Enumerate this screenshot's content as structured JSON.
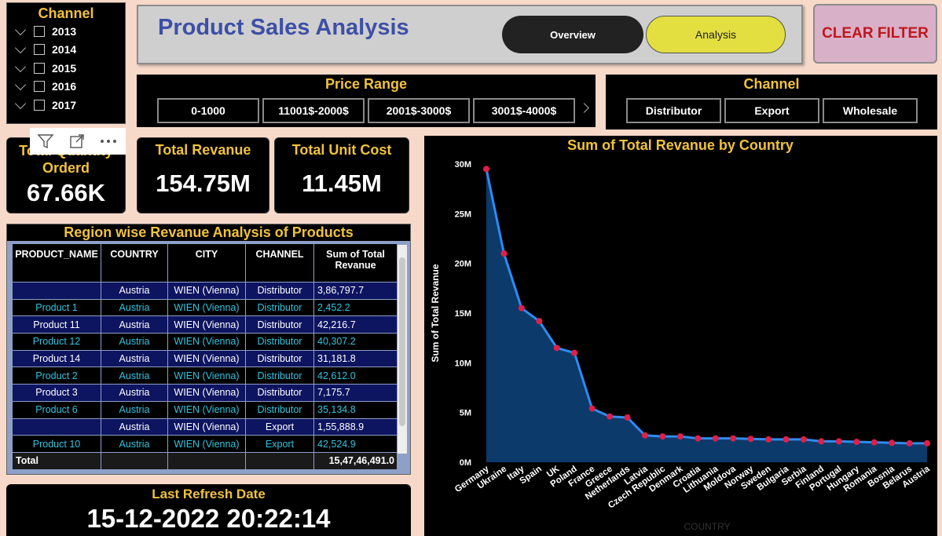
{
  "slicer_year": {
    "title": "Channel",
    "items": [
      "2013",
      "2014",
      "2015",
      "2016",
      "2017"
    ]
  },
  "header": {
    "title": "Product Sales Analysis",
    "btn_overview": "Overview",
    "btn_analysis": "Analysis"
  },
  "clear_filter": "CLEAR FILTER",
  "price_range": {
    "title": "Price Range",
    "options": [
      "0-1000",
      "11001$-2000$",
      "2001$-3000$",
      "3001$-4000$"
    ]
  },
  "channel_slicer": {
    "title": "Channel",
    "options": [
      "Distributor",
      "Export",
      "Wholesale"
    ]
  },
  "kpis": {
    "qty_label": "Total Quantity Orderd",
    "qty_value": "67.66K",
    "rev_label": "Total Revanue",
    "rev_value": "154.75M",
    "cost_label": "Total Unit Cost",
    "cost_value": "11.45M"
  },
  "table": {
    "title": "Region wise Revanue Analysis of Products",
    "columns": [
      "PRODUCT_NAME",
      "COUNTRY",
      "CITY",
      "CHANNEL",
      "Sum of Total Revanue"
    ],
    "rows": [
      [
        "",
        "Austria",
        "WIEN (Vienna)",
        "Distributor",
        "3,86,797.7"
      ],
      [
        "Product 1",
        "Austria",
        "WIEN (Vienna)",
        "Distributor",
        "2,452.2"
      ],
      [
        "Product 11",
        "Austria",
        "WIEN (Vienna)",
        "Distributor",
        "42,216.7"
      ],
      [
        "Product 12",
        "Austria",
        "WIEN (Vienna)",
        "Distributor",
        "40,307.2"
      ],
      [
        "Product 14",
        "Austria",
        "WIEN (Vienna)",
        "Distributor",
        "31,181.8"
      ],
      [
        "Product 2",
        "Austria",
        "WIEN (Vienna)",
        "Distributor",
        "42,612.0"
      ],
      [
        "Product 3",
        "Austria",
        "WIEN (Vienna)",
        "Distributor",
        "7,175.7"
      ],
      [
        "Product 6",
        "Austria",
        "WIEN (Vienna)",
        "Distributor",
        "35,134.8"
      ],
      [
        "",
        "Austria",
        "WIEN (Vienna)",
        "Export",
        "1,55,888.9"
      ],
      [
        "Product 10",
        "Austria",
        "WIEN (Vienna)",
        "Export",
        "42,524.9"
      ]
    ],
    "total_label": "Total",
    "total_value": "15,47,46,491.0"
  },
  "refresh": {
    "label": "Last Refresh Date",
    "value": "15-12-2022 20:22:14"
  },
  "chart_data": {
    "type": "area",
    "title": "Sum of Total Revanue by Country",
    "xlabel": "COUNTRY",
    "ylabel": "Sum of Total Revanue",
    "yticks": [
      "0M",
      "5M",
      "10M",
      "15M",
      "20M",
      "25M",
      "30M"
    ],
    "ylim": [
      0,
      30
    ],
    "categories": [
      "Germany",
      "Ukraine",
      "Italy",
      "Spain",
      "UK",
      "Poland",
      "France",
      "Greece",
      "Netherlands",
      "Latvia",
      "Czech Republic",
      "Denmark",
      "Croatia",
      "Lithuania",
      "Moldova",
      "Norway",
      "Sweden",
      "Bulgaria",
      "Serbia",
      "Finland",
      "Portugal",
      "Hungary",
      "Romania",
      "Bosnia",
      "Belarus",
      "Austria"
    ],
    "series": [
      {
        "values": [
          29.5,
          21.0,
          15.5,
          14.2,
          11.5,
          11.0,
          5.4,
          4.6,
          4.5,
          2.7,
          2.6,
          2.6,
          2.4,
          2.4,
          2.4,
          2.35,
          2.3,
          2.3,
          2.3,
          2.1,
          2.1,
          2.05,
          2.0,
          1.95,
          1.9,
          1.9
        ]
      }
    ],
    "colors": {
      "line": "#2d8cf0",
      "fill": "#0c3a6b",
      "marker": "#e0204a"
    }
  }
}
